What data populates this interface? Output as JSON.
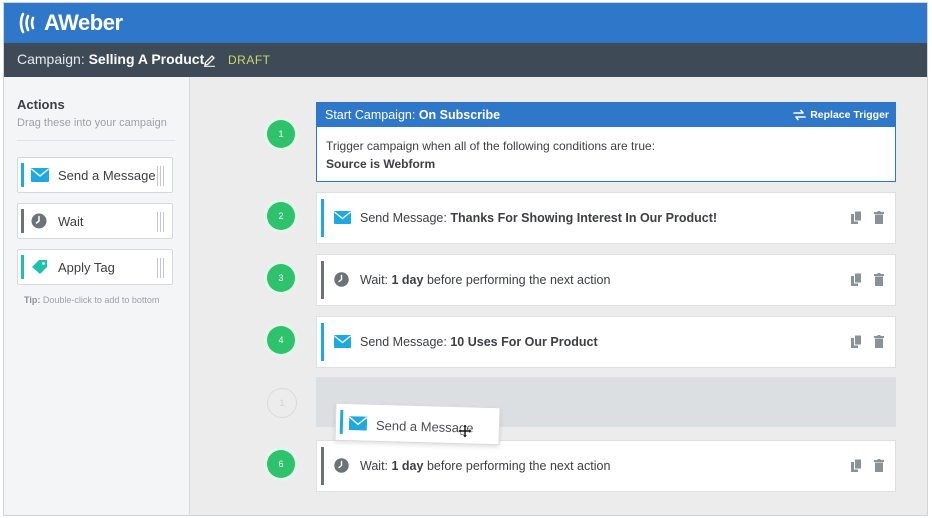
{
  "app": {
    "logo_text": "AWeber"
  },
  "campaign": {
    "label": "Campaign:",
    "name": "Selling A Product",
    "status": "DRAFT"
  },
  "sidebar": {
    "title": "Actions",
    "subtitle": "Drag these into your campaign",
    "items": [
      {
        "label": "Send a Message",
        "icon": "envelope-icon",
        "color": "#1fa9e1"
      },
      {
        "label": "Wait",
        "icon": "clock-icon",
        "color": "#6b7278"
      },
      {
        "label": "Apply Tag",
        "icon": "tag-icon",
        "color": "#1fbfae"
      }
    ],
    "tip_prefix": "Tip:",
    "tip_text": " Double-click to add to bottom"
  },
  "canvas": {
    "trigger": {
      "number": "1",
      "title_prefix": "Start Campaign:",
      "title_value": "On Subscribe",
      "replace_label": "Replace Trigger",
      "description": "Trigger campaign when all of the following conditions are true:",
      "condition": "Source is Webform"
    },
    "steps": [
      {
        "number": "2",
        "type": "message",
        "prefix": "Send Message:",
        "value": "Thanks For Showing Interest In Our Product!",
        "suffix": ""
      },
      {
        "number": "3",
        "type": "wait",
        "prefix": "Wait:",
        "value": "1 day",
        "suffix": "before performing the next action"
      },
      {
        "number": "4",
        "type": "message",
        "prefix": "Send Message:",
        "value": "10 Uses For Our Product",
        "suffix": ""
      },
      {
        "number": "6",
        "type": "wait",
        "prefix": "Wait:",
        "value": "1 day",
        "suffix": "before performing the next action"
      }
    ],
    "drop_placeholder_number": "1",
    "dragging_label": "Send a Message"
  },
  "colors": {
    "brand_blue": "#2f77c8",
    "campaign_bar": "#3e4b57",
    "step_green": "#2dc26b",
    "message_accent": "#1fa9e1",
    "wait_accent": "#6b7278",
    "tag_accent": "#1fbfae",
    "draft_yellow": "#c9d671"
  }
}
